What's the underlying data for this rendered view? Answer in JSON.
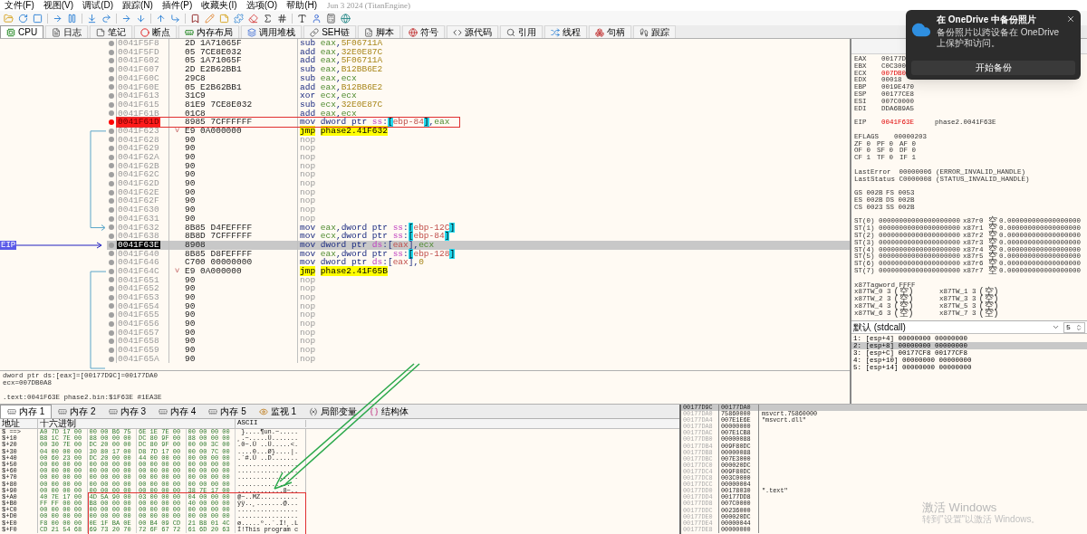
{
  "menu": [
    "文件(F)",
    "视图(V)",
    "调试(D)",
    "跟踪(N)",
    "插件(P)",
    "收藏夹(I)",
    "选项(O)",
    "帮助(H)"
  ],
  "build": "Jun 3 2024 (TitanEngine)",
  "tabs": [
    {
      "label": "CPU",
      "selected": true
    },
    {
      "label": "日志",
      "selected": false
    },
    {
      "label": "笔记",
      "selected": false
    },
    {
      "label": "断点",
      "selected": false
    },
    {
      "label": "内存布局",
      "selected": false
    },
    {
      "label": "调用堆栈",
      "selected": false
    },
    {
      "label": "SEH链",
      "selected": false
    },
    {
      "label": "脚本",
      "selected": false
    },
    {
      "label": "符号",
      "selected": false
    },
    {
      "label": "源代码",
      "selected": false
    },
    {
      "label": "引用",
      "selected": false
    },
    {
      "label": "线程",
      "selected": false
    },
    {
      "label": "句柄",
      "selected": false
    },
    {
      "label": "跟踪",
      "selected": false
    }
  ],
  "disassembly": {
    "eip_label": "EIP",
    "rows": [
      {
        "address": "0041F5F8",
        "bytes": "2D 1A71065F",
        "kind": "normal",
        "mnemonic": "sub",
        "operands": [
          {
            "t": "eax",
            "kind": "reg"
          },
          {
            "t": ",",
            "kind": "p"
          },
          {
            "t": "5F06711A",
            "kind": "num"
          }
        ],
        "breakpoint": false,
        "selected": false
      },
      {
        "address": "0041F5FD",
        "bytes": "05 7CE8E032",
        "kind": "normal",
        "mnemonic": "add",
        "operands": [
          {
            "t": "eax",
            "kind": "reg"
          },
          {
            "t": ",",
            "kind": "p"
          },
          {
            "t": "32E0E87C",
            "kind": "num"
          }
        ],
        "breakpoint": false,
        "selected": false
      },
      {
        "address": "0041F602",
        "bytes": "05 1A71065F",
        "kind": "normal",
        "mnemonic": "add",
        "operands": [
          {
            "t": "eax",
            "kind": "reg"
          },
          {
            "t": ",",
            "kind": "p"
          },
          {
            "t": "5F06711A",
            "kind": "num"
          }
        ],
        "breakpoint": false,
        "selected": false
      },
      {
        "address": "0041F607",
        "bytes": "2D E2B62BB1",
        "kind": "normal",
        "mnemonic": "sub",
        "operands": [
          {
            "t": "eax",
            "kind": "reg"
          },
          {
            "t": ",",
            "kind": "p"
          },
          {
            "t": "B12BB6E2",
            "kind": "num"
          }
        ],
        "breakpoint": false,
        "selected": false
      },
      {
        "address": "0041F60C",
        "bytes": "29C8",
        "kind": "normal",
        "mnemonic": "sub",
        "operands": [
          {
            "t": "eax",
            "kind": "reg"
          },
          {
            "t": ",",
            "kind": "p"
          },
          {
            "t": "ecx",
            "kind": "reg"
          }
        ],
        "breakpoint": false,
        "selected": false
      },
      {
        "address": "0041F60E",
        "bytes": "05 E2B62BB1",
        "kind": "normal",
        "mnemonic": "add",
        "operands": [
          {
            "t": "eax",
            "kind": "reg"
          },
          {
            "t": ",",
            "kind": "p"
          },
          {
            "t": "B12BB6E2",
            "kind": "num"
          }
        ],
        "breakpoint": false,
        "selected": false
      },
      {
        "address": "0041F613",
        "bytes": "31C9",
        "kind": "normal",
        "mnemonic": "xor",
        "operands": [
          {
            "t": "ecx",
            "kind": "reg"
          },
          {
            "t": ",",
            "kind": "p"
          },
          {
            "t": "ecx",
            "kind": "reg"
          }
        ],
        "breakpoint": false,
        "selected": false
      },
      {
        "address": "0041F615",
        "bytes": "81E9 7CE8E032",
        "kind": "normal",
        "mnemonic": "sub",
        "operands": [
          {
            "t": "ecx",
            "kind": "reg"
          },
          {
            "t": ",",
            "kind": "p"
          },
          {
            "t": "32E0E87C",
            "kind": "num"
          }
        ],
        "breakpoint": false,
        "selected": false
      },
      {
        "address": "0041F61B",
        "bytes": "01C8",
        "kind": "normal",
        "mnemonic": "add",
        "operands": [
          {
            "t": "eax",
            "kind": "reg"
          },
          {
            "t": ",",
            "kind": "p"
          },
          {
            "t": "ecx",
            "kind": "reg"
          }
        ],
        "breakpoint": false,
        "selected": false
      },
      {
        "address": "0041F61D",
        "bytes": "8985 7CFFFFFF",
        "kind": "normal",
        "mnemonic": "mov",
        "operands": [
          {
            "t": "dword ptr",
            "kind": "kw"
          },
          {
            "t": "ss",
            "kind": "seg"
          },
          {
            "t": ":",
            "kind": "p"
          },
          {
            "t": "[",
            "kind": "brk"
          },
          {
            "t": "ebp-84",
            "kind": "mem"
          },
          {
            "t": "]",
            "kind": "brk"
          },
          {
            "t": ",",
            "kind": "p"
          },
          {
            "t": "eax",
            "kind": "reg"
          }
        ],
        "breakpoint": true,
        "selected": false
      },
      {
        "address": "0041F623",
        "flag": "˅",
        "bytes": "E9 0A000000",
        "kind": "jump",
        "mnemonic": "jmp",
        "operands": [
          {
            "t": "phase2.41F632",
            "kind": "lbl"
          }
        ],
        "breakpoint": false,
        "selected": false
      },
      {
        "address": "0041F628",
        "bytes": "90",
        "kind": "nop",
        "mnemonic": "nop",
        "operands": [],
        "breakpoint": false,
        "selected": false
      },
      {
        "address": "0041F629",
        "bytes": "90",
        "kind": "nop",
        "mnemonic": "nop",
        "operands": [],
        "breakpoint": false,
        "selected": false
      },
      {
        "address": "0041F62A",
        "bytes": "90",
        "kind": "nop",
        "mnemonic": "nop",
        "operands": [],
        "breakpoint": false,
        "selected": false
      },
      {
        "address": "0041F62B",
        "bytes": "90",
        "kind": "nop",
        "mnemonic": "nop",
        "operands": [],
        "breakpoint": false,
        "selected": false
      },
      {
        "address": "0041F62C",
        "bytes": "90",
        "kind": "nop",
        "mnemonic": "nop",
        "operands": [],
        "breakpoint": false,
        "selected": false
      },
      {
        "address": "0041F62D",
        "bytes": "90",
        "kind": "nop",
        "mnemonic": "nop",
        "operands": [],
        "breakpoint": false,
        "selected": false
      },
      {
        "address": "0041F62E",
        "bytes": "90",
        "kind": "nop",
        "mnemonic": "nop",
        "operands": [],
        "breakpoint": false,
        "selected": false
      },
      {
        "address": "0041F62F",
        "bytes": "90",
        "kind": "nop",
        "mnemonic": "nop",
        "operands": [],
        "breakpoint": false,
        "selected": false
      },
      {
        "address": "0041F630",
        "bytes": "90",
        "kind": "nop",
        "mnemonic": "nop",
        "operands": [],
        "breakpoint": false,
        "selected": false
      },
      {
        "address": "0041F631",
        "bytes": "90",
        "kind": "nop",
        "mnemonic": "nop",
        "operands": [],
        "breakpoint": false,
        "selected": false
      },
      {
        "address": "0041F632",
        "bytes": "8B85 D4FEFFFF",
        "kind": "normal",
        "mnemonic": "mov",
        "operands": [
          {
            "t": "eax",
            "kind": "reg"
          },
          {
            "t": ",",
            "kind": "p"
          },
          {
            "t": "dword ptr",
            "kind": "kw"
          },
          {
            "t": "ss",
            "kind": "seg"
          },
          {
            "t": ":",
            "kind": "p"
          },
          {
            "t": "[",
            "kind": "brk"
          },
          {
            "t": "ebp-12C",
            "kind": "mem"
          },
          {
            "t": "]",
            "kind": "brk"
          }
        ],
        "breakpoint": false,
        "selected": false
      },
      {
        "address": "0041F638",
        "bytes": "8B8D 7CFFFFFF",
        "kind": "normal",
        "mnemonic": "mov",
        "operands": [
          {
            "t": "ecx",
            "kind": "reg"
          },
          {
            "t": ",",
            "kind": "p"
          },
          {
            "t": "dword ptr",
            "kind": "kw"
          },
          {
            "t": "ss",
            "kind": "seg"
          },
          {
            "t": ":",
            "kind": "p"
          },
          {
            "t": "[",
            "kind": "brk"
          },
          {
            "t": "ebp-84",
            "kind": "mem"
          },
          {
            "t": "]",
            "kind": "brk"
          }
        ],
        "breakpoint": false,
        "selected": false
      },
      {
        "address": "0041F63E",
        "bytes": "8908",
        "kind": "normal",
        "mnemonic": "mov",
        "operands": [
          {
            "t": "dword ptr",
            "kind": "kw"
          },
          {
            "t": "ds",
            "kind": "seg"
          },
          {
            "t": ":",
            "kind": "p"
          },
          {
            "t": "[",
            "kind": "br"
          },
          {
            "t": "eax",
            "kind": "mem"
          },
          {
            "t": "]",
            "kind": "br"
          },
          {
            "t": ",",
            "kind": "p"
          },
          {
            "t": "ecx",
            "kind": "reg"
          }
        ],
        "breakpoint": false,
        "selected": true
      },
      {
        "address": "0041F640",
        "bytes": "8B85 D8FEFFFF",
        "kind": "normal",
        "mnemonic": "mov",
        "operands": [
          {
            "t": "eax",
            "kind": "reg"
          },
          {
            "t": ",",
            "kind": "p"
          },
          {
            "t": "dword ptr",
            "kind": "kw"
          },
          {
            "t": "ss",
            "kind": "seg"
          },
          {
            "t": ":",
            "kind": "p"
          },
          {
            "t": "[",
            "kind": "brk"
          },
          {
            "t": "ebp-128",
            "kind": "mem"
          },
          {
            "t": "]",
            "kind": "brk"
          }
        ],
        "breakpoint": false,
        "selected": false
      },
      {
        "address": "0041F646",
        "bytes": "C700 00000000",
        "kind": "normal",
        "mnemonic": "mov",
        "operands": [
          {
            "t": "dword ptr",
            "kind": "kw"
          },
          {
            "t": "ds",
            "kind": "seg"
          },
          {
            "t": ":",
            "kind": "p"
          },
          {
            "t": "[",
            "kind": "br"
          },
          {
            "t": "eax",
            "kind": "mem"
          },
          {
            "t": "]",
            "kind": "br"
          },
          {
            "t": ",",
            "kind": "p"
          },
          {
            "t": "0",
            "kind": "num"
          }
        ],
        "breakpoint": false,
        "selected": false
      },
      {
        "address": "0041F64C",
        "flag": "˅",
        "bytes": "E9 0A000000",
        "kind": "jump",
        "mnemonic": "jmp",
        "operands": [
          {
            "t": "phase2.41F65B",
            "kind": "lbl"
          }
        ],
        "breakpoint": false,
        "selected": false
      },
      {
        "address": "0041F651",
        "bytes": "90",
        "kind": "nop",
        "mnemonic": "nop",
        "operands": [],
        "breakpoint": false,
        "selected": false
      },
      {
        "address": "0041F652",
        "bytes": "90",
        "kind": "nop",
        "mnemonic": "nop",
        "operands": [],
        "breakpoint": false,
        "selected": false
      },
      {
        "address": "0041F653",
        "bytes": "90",
        "kind": "nop",
        "mnemonic": "nop",
        "operands": [],
        "breakpoint": false,
        "selected": false
      },
      {
        "address": "0041F654",
        "bytes": "90",
        "kind": "nop",
        "mnemonic": "nop",
        "operands": [],
        "breakpoint": false,
        "selected": false
      },
      {
        "address": "0041F655",
        "bytes": "90",
        "kind": "nop",
        "mnemonic": "nop",
        "operands": [],
        "breakpoint": false,
        "selected": false
      },
      {
        "address": "0041F656",
        "bytes": "90",
        "kind": "nop",
        "mnemonic": "nop",
        "operands": [],
        "breakpoint": false,
        "selected": false
      },
      {
        "address": "0041F657",
        "bytes": "90",
        "kind": "nop",
        "mnemonic": "nop",
        "operands": [],
        "breakpoint": false,
        "selected": false
      },
      {
        "address": "0041F658",
        "bytes": "90",
        "kind": "nop",
        "mnemonic": "nop",
        "operands": [],
        "breakpoint": false,
        "selected": false
      },
      {
        "address": "0041F659",
        "bytes": "90",
        "kind": "nop",
        "mnemonic": "nop",
        "operands": [],
        "breakpoint": false,
        "selected": false
      },
      {
        "address": "0041F65A",
        "bytes": "90",
        "kind": "nop",
        "mnemonic": "nop",
        "operands": [],
        "breakpoint": false,
        "selected": false
      }
    ]
  },
  "info": {
    "values": [
      "dword ptr ds:[eax]=[00177D9C]=00177DA0",
      "ecx=007DB0A8"
    ],
    "location": ".text:0041F63E phase2.bin:$1F63E #1EA3E"
  },
  "registers": {
    "general": [
      {
        "name": "EAX",
        "value": "00177D",
        "changed": false
      },
      {
        "name": "EBX",
        "value": "C0C300",
        "changed": false
      },
      {
        "name": "ECX",
        "value": "007DB0",
        "changed": true
      },
      {
        "name": "EDX",
        "value": "00018",
        "changed": false
      },
      {
        "name": "EBP",
        "value": "0019E470",
        "changed": false
      },
      {
        "name": "ESP",
        "value": "00177CE8",
        "changed": false
      },
      {
        "name": "ESI",
        "value": "007C0000",
        "changed": false
      },
      {
        "name": "EDI",
        "value": "DDA6B9A5",
        "changed": false
      }
    ],
    "eip": {
      "name": "EIP",
      "value": "0041F63E",
      "comment": "phase2.0041F63E",
      "changed": true
    },
    "eflags": {
      "name": "EFLAGS",
      "value": "00000203"
    },
    "flags": [
      [
        "ZF 0",
        "PF 0",
        "AF 0"
      ],
      [
        "OF 0",
        "SF 0",
        "DF 0"
      ],
      [
        "CF 1",
        "TF 0",
        "IF 1"
      ]
    ],
    "status": [
      "LastError  00000006 (ERROR_INVALID_HANDLE)",
      "LastStatus C0000008 (STATUS_INVALID_HANDLE)"
    ],
    "segments": [
      [
        "GS 002B",
        "FS 0053"
      ],
      [
        "ES 002B",
        "DS 002B"
      ],
      [
        "CS 0023",
        "SS 002B"
      ]
    ],
    "fpu": [
      {
        "name": "ST(0)",
        "raw": "00000000000000000000",
        "reg": "x87r0",
        "tag": "空",
        "value": "0.000000000000000000"
      },
      {
        "name": "ST(1)",
        "raw": "00000000000000000000",
        "reg": "x87r1",
        "tag": "空",
        "value": "0.000000000000000000"
      },
      {
        "name": "ST(2)",
        "raw": "00000000000000000000",
        "reg": "x87r2",
        "tag": "空",
        "value": "0.000000000000000000"
      },
      {
        "name": "ST(3)",
        "raw": "00000000000000000000",
        "reg": "x87r3",
        "tag": "空",
        "value": "0.000000000000000000"
      },
      {
        "name": "ST(4)",
        "raw": "00000000000000000000",
        "reg": "x87r4",
        "tag": "空",
        "value": "0.000000000000000000"
      },
      {
        "name": "ST(5)",
        "raw": "00000000000000000000",
        "reg": "x87r5",
        "tag": "空",
        "value": "0.000000000000000000"
      },
      {
        "name": "ST(6)",
        "raw": "00000000000000000000",
        "reg": "x87r6",
        "tag": "空",
        "value": "0.000000000000000000"
      },
      {
        "name": "ST(7)",
        "raw": "00000000000000000000",
        "reg": "x87r7",
        "tag": "空",
        "value": "0.000000000000000000"
      }
    ],
    "tagword": "x87Tagword FFFF",
    "tag_words": [
      {
        "label": "x87TW_0 3",
        "tag": "(空)"
      },
      {
        "label": "x87TW_1 3",
        "tag": "(空)"
      },
      {
        "label": "x87TW_2 3",
        "tag": "(空)"
      },
      {
        "label": "x87TW_3 3",
        "tag": "(空)"
      },
      {
        "label": "x87TW_4 3",
        "tag": "(空)"
      },
      {
        "label": "x87TW_5 3",
        "tag": "(空)"
      },
      {
        "label": "x87TW_6 3",
        "tag": "(空)"
      },
      {
        "label": "x87TW_7 3",
        "tag": "(空)"
      }
    ]
  },
  "call_args": {
    "convention": "默认 (stdcall)",
    "count": "5",
    "rows": [
      {
        "text": "1: [esp+4] 00000000 00000000",
        "selected": false
      },
      {
        "text": "2: [esp+8] 00000000 00000000",
        "selected": true
      },
      {
        "text": "3: [esp+C] 00177CF8 00177CF8",
        "selected": false
      },
      {
        "text": "4: [esp+10] 00000000 00000000",
        "selected": false
      },
      {
        "text": "5: [esp+14] 00000000 00000000",
        "selected": false
      }
    ]
  },
  "memory_tabs": [
    {
      "label": "内存 1",
      "kind": "memory",
      "selected": true
    },
    {
      "label": "内存 2",
      "kind": "memory",
      "selected": false
    },
    {
      "label": "内存 3",
      "kind": "memory",
      "selected": false
    },
    {
      "label": "内存 4",
      "kind": "memory",
      "selected": false
    },
    {
      "label": "内存 5",
      "kind": "memory",
      "selected": false
    },
    {
      "label": "监视 1",
      "kind": "watch",
      "selected": false
    },
    {
      "label": "局部变量",
      "kind": "locals",
      "selected": false
    },
    {
      "label": "结构体",
      "kind": "struct",
      "selected": false
    }
  ],
  "dump": {
    "columns": [
      "地址",
      "十六进制",
      "ASCII"
    ],
    "rows": [
      {
        "address": "$ ==>",
        "hex": [
          "A0 7D 17 00",
          "00 00 B6 75",
          "6E 1E 7E 00",
          "00 00 00 00"
        ],
        "ascii": " }....¶un.~....."
      },
      {
        "address": "$+10",
        "hex": [
          "B8 1C 7E 00",
          "88 00 00 00",
          "DC 80 9F 00",
          "88 00 00 00"
        ],
        "ascii": "¸.~.....Ü......."
      },
      {
        "address": "$+20",
        "hex": [
          "00 30 7E 00",
          "DC 20 00 00",
          "DC 80 9F 00",
          "00 00 3C 00"
        ],
        "ascii": ".0~.Ü ..Ü.....<."
      },
      {
        "address": "$+30",
        "hex": [
          "04 00 00 00",
          "30 80 17 00",
          "D8 7D 17 00",
          "00 00 7C 00"
        ],
        "ascii": "....0...Ø}....|."
      },
      {
        "address": "$+40",
        "hex": [
          "00 60 23 00",
          "DC 20 00 00",
          "44 00 00 00",
          "00 00 00 00"
        ],
        "ascii": ".`#.Ü ..D......."
      },
      {
        "address": "$+50",
        "hex": [
          "00 00 00 00",
          "00 00 00 00",
          "00 00 00 00",
          "00 00 00 00"
        ],
        "ascii": "................"
      },
      {
        "address": "$+60",
        "hex": [
          "00 00 00 00",
          "00 00 00 00",
          "00 00 00 00",
          "00 00 00 00"
        ],
        "ascii": "................"
      },
      {
        "address": "$+70",
        "hex": [
          "00 00 00 00",
          "00 00 00 00",
          "00 00 00 00",
          "00 00 00 00"
        ],
        "ascii": "................"
      },
      {
        "address": "$+80",
        "hex": [
          "00 00 00 00",
          "00 00 00 00",
          "00 00 00 00",
          "00 00 00 00"
        ],
        "ascii": "................"
      },
      {
        "address": "$+90",
        "hex": [
          "00 00 00 00",
          "00 00 00 00",
          "00 00 00 00",
          "38 7E 17 00"
        ],
        "ascii": "............8~.."
      },
      {
        "address": "$+A0",
        "hex": [
          "40 7E 17 00",
          "4D 5A 90 00",
          "03 00 00 00",
          "04 00 00 00"
        ],
        "ascii": "@~..MZ.........."
      },
      {
        "address": "$+B0",
        "hex": [
          "FF FF 00 00",
          "B8 00 00 00",
          "00 00 00 00",
          "40 00 00 00"
        ],
        "ascii": "ÿÿ..¸.......@..."
      },
      {
        "address": "$+C0",
        "hex": [
          "00 00 00 00",
          "00 00 00 00",
          "00 00 00 00",
          "00 00 00 00"
        ],
        "ascii": "................"
      },
      {
        "address": "$+D0",
        "hex": [
          "00 00 00 00",
          "00 00 00 00",
          "00 00 00 00",
          "00 00 00 00"
        ],
        "ascii": "................"
      },
      {
        "address": "$+E0",
        "hex": [
          "F8 00 00 00",
          "0E 1F BA 0E",
          "00 B4 09 CD",
          "21 B8 01 4C"
        ],
        "ascii": "ø.....º..´.Í!¸.L"
      },
      {
        "address": "$+F0",
        "hex": [
          "CD 21 54 68",
          "69 73 20 70",
          "72 6F 67 72",
          "61 6D 20 63"
        ],
        "ascii": "Í!This program c"
      }
    ]
  },
  "stack": {
    "rows": [
      {
        "address": "00177D9C",
        "value": "00177DA0",
        "selected": true
      },
      {
        "address": "00177DA0",
        "value": "75860000",
        "comment": "msvcrt.75860000",
        "selected": false
      },
      {
        "address": "00177DA4",
        "value": "007E1E6E",
        "comment": "\"msvcrt.dll\"",
        "selected": false
      },
      {
        "address": "00177DA8",
        "value": "00000000",
        "selected": false
      },
      {
        "address": "00177DAC",
        "value": "007E1CB8",
        "selected": false
      },
      {
        "address": "00177DB0",
        "value": "00000088",
        "selected": false
      },
      {
        "address": "00177DB4",
        "value": "009F80DC",
        "selected": false
      },
      {
        "address": "00177DB8",
        "value": "00000088",
        "selected": false
      },
      {
        "address": "00177DBC",
        "value": "007E3000",
        "selected": false
      },
      {
        "address": "00177DC0",
        "value": "000020DC",
        "selected": false
      },
      {
        "address": "00177DC4",
        "value": "009F80DC",
        "selected": false
      },
      {
        "address": "00177DC8",
        "value": "003C0000",
        "selected": false
      },
      {
        "address": "00177DCC",
        "value": "00000004",
        "selected": false
      },
      {
        "address": "00177DD0",
        "value": "00178030",
        "comment": "\".text\"",
        "selected": false
      },
      {
        "address": "00177DD4",
        "value": "00177DD8",
        "selected": false
      },
      {
        "address": "00177DD8",
        "value": "007C0000",
        "selected": false
      },
      {
        "address": "00177DDC",
        "value": "00236000",
        "selected": false
      },
      {
        "address": "00177DE0",
        "value": "000020DC",
        "selected": false
      },
      {
        "address": "00177DE4",
        "value": "00000044",
        "selected": false
      },
      {
        "address": "00177DE8",
        "value": "00000000",
        "selected": false
      }
    ]
  },
  "toast": {
    "title": "在 OneDrive 中备份照片",
    "body": "备份照片以跨设备在 OneDrive 上保护和访问。",
    "button": "开始备份"
  },
  "activation": {
    "title": "激活 Windows",
    "body": "转到\"设置\"以激活 Windows。"
  }
}
